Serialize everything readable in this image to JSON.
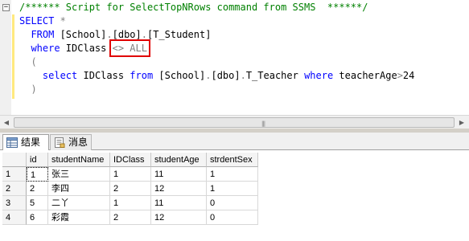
{
  "editor": {
    "lines": [
      [
        {
          "c": "cm",
          "t": "/****** Script for SelectTopNRows command from SSMS  ******/"
        }
      ],
      [
        {
          "c": "kw",
          "t": "SELECT"
        },
        {
          "c": "tx",
          "t": " "
        },
        {
          "c": "gr",
          "t": "*"
        }
      ],
      [
        {
          "c": "tx",
          "t": "  "
        },
        {
          "c": "kw",
          "t": "FROM"
        },
        {
          "c": "tx",
          "t": " [School]"
        },
        {
          "c": "gr",
          "t": "."
        },
        {
          "c": "tx",
          "t": "[dbo]"
        },
        {
          "c": "gr",
          "t": "."
        },
        {
          "c": "tx",
          "t": "[T_Student]"
        }
      ],
      [
        {
          "c": "tx",
          "t": "  "
        },
        {
          "c": "kw",
          "t": "where"
        },
        {
          "c": "tx",
          "t": " IDClass "
        },
        {
          "c": "gr hl",
          "t": "<> ALL"
        }
      ],
      [
        {
          "c": "tx",
          "t": "  "
        },
        {
          "c": "gr",
          "t": "("
        }
      ],
      [
        {
          "c": "tx",
          "t": "    "
        },
        {
          "c": "kw",
          "t": "select"
        },
        {
          "c": "tx",
          "t": " IDClass "
        },
        {
          "c": "kw",
          "t": "from"
        },
        {
          "c": "tx",
          "t": " [School]"
        },
        {
          "c": "gr",
          "t": "."
        },
        {
          "c": "tx",
          "t": "[dbo]"
        },
        {
          "c": "gr",
          "t": "."
        },
        {
          "c": "tx",
          "t": "T_Teacher "
        },
        {
          "c": "kw",
          "t": "where"
        },
        {
          "c": "tx",
          "t": " teacherAge"
        },
        {
          "c": "gr",
          "t": ">"
        },
        {
          "c": "tx",
          "t": "24"
        }
      ],
      [
        {
          "c": "tx",
          "t": "  "
        },
        {
          "c": "gr",
          "t": ")"
        }
      ]
    ]
  },
  "tabs": {
    "results": "结果",
    "messages": "消息"
  },
  "grid": {
    "columns": [
      "id",
      "studentName",
      "IDClass",
      "studentAge",
      "strdentSex"
    ],
    "rows": [
      {
        "num": "1",
        "cells": [
          "1",
          "张三",
          "1",
          "11",
          "1"
        ]
      },
      {
        "num": "2",
        "cells": [
          "2",
          "李四",
          "2",
          "12",
          "1"
        ]
      },
      {
        "num": "3",
        "cells": [
          "5",
          "二丫",
          "1",
          "11",
          "0"
        ]
      },
      {
        "num": "4",
        "cells": [
          "6",
          "彩霞",
          "2",
          "12",
          "0"
        ]
      }
    ]
  },
  "colors": {
    "keyword": "#0000ff",
    "comment": "#008000",
    "operator": "#808080",
    "highlight_box": "#e00000"
  }
}
